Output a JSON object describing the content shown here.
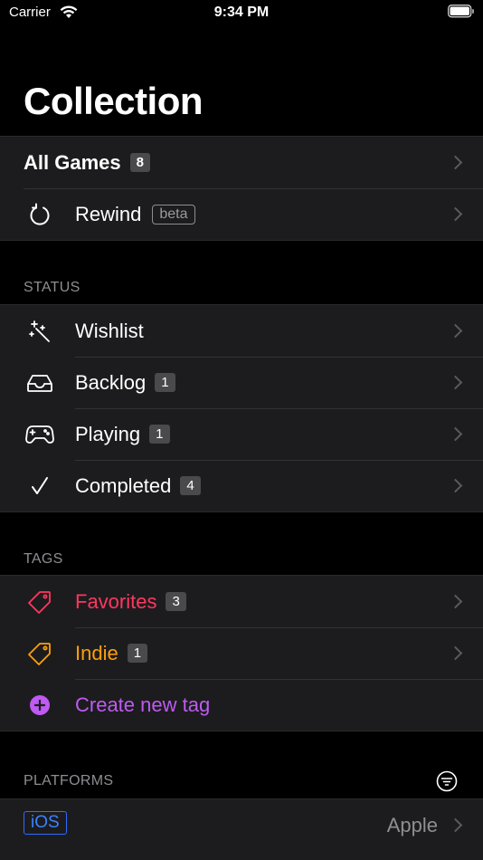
{
  "status_bar": {
    "carrier": "Carrier",
    "time": "9:34 PM"
  },
  "title": "Collection",
  "top": [
    {
      "label": "All Games",
      "badge": "8"
    },
    {
      "label": "Rewind",
      "tag": "beta",
      "icon": "rewind-icon"
    }
  ],
  "status": {
    "header": "STATUS",
    "items": [
      {
        "label": "Wishlist",
        "icon": "wand-icon"
      },
      {
        "label": "Backlog",
        "badge": "1",
        "icon": "inbox-tray-icon"
      },
      {
        "label": "Playing",
        "badge": "1",
        "icon": "gamepad-icon"
      },
      {
        "label": "Completed",
        "badge": "4",
        "icon": "checkmark-icon"
      }
    ]
  },
  "tags": {
    "header": "TAGS",
    "items": [
      {
        "label": "Favorites",
        "badge": "3",
        "color": "#ff375f",
        "icon": "tag-icon"
      },
      {
        "label": "Indie",
        "badge": "1",
        "color": "#ff9f0a",
        "icon": "tag-icon"
      }
    ],
    "create_label": "Create new tag",
    "create_color": "#bf5af2"
  },
  "platforms": {
    "header": "PLATFORMS",
    "items": [
      {
        "label": "iOS",
        "detail": "Apple",
        "color": "#3b82ff"
      }
    ]
  }
}
